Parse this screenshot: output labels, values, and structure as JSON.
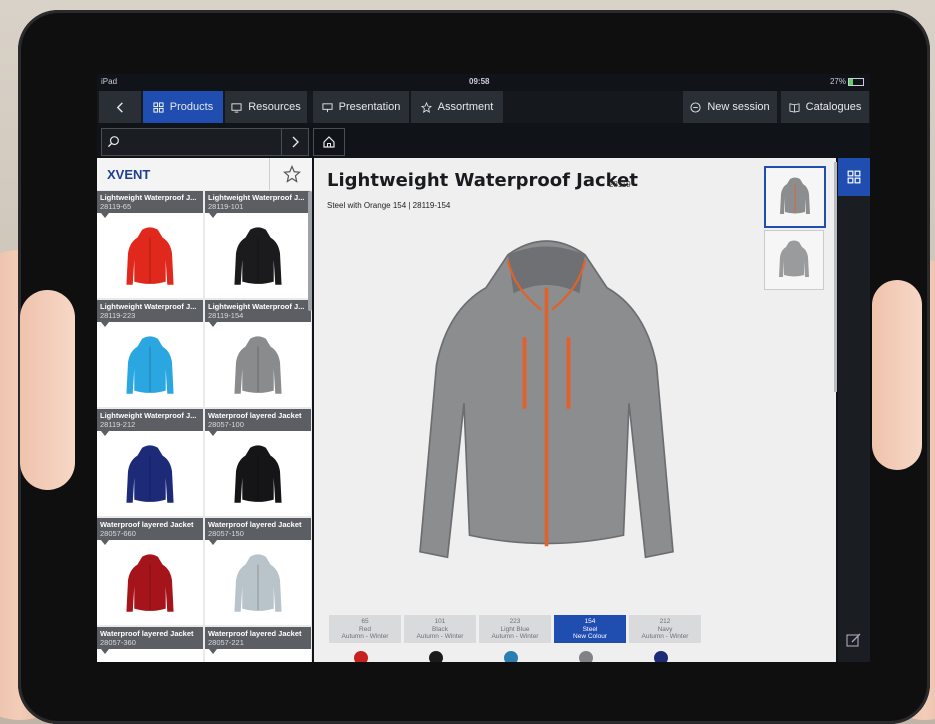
{
  "status": {
    "carrier": "iPad",
    "time": "09:58",
    "battery": "27%"
  },
  "nav": {
    "back_icon": "chevron-left-icon",
    "tabs": [
      {
        "label": "Products",
        "icon": "grid-icon",
        "active": true
      },
      {
        "label": "Resources",
        "icon": "monitor-icon",
        "active": false
      },
      {
        "label": "Presentation",
        "icon": "presentation-icon",
        "active": false
      },
      {
        "label": "Assortment",
        "icon": "star-icon",
        "active": false
      }
    ],
    "right": [
      {
        "label": "New session",
        "icon": "plus-circle-icon"
      },
      {
        "label": "Catalogues",
        "icon": "book-icon"
      }
    ]
  },
  "search": {
    "placeholder": "",
    "value": ""
  },
  "list": {
    "brand": "XVENT",
    "items": [
      {
        "name": "Lightweight Waterproof J...",
        "code": "28119-65",
        "color": "#e0281c"
      },
      {
        "name": "Lightweight Waterproof J...",
        "code": "28119-101",
        "color": "#1b1b1d"
      },
      {
        "name": "Lightweight Waterproof J...",
        "code": "28119-223",
        "color": "#2aa7e0"
      },
      {
        "name": "Lightweight Waterproof J...",
        "code": "28119-154",
        "color": "#8a8b8d"
      },
      {
        "name": "Lightweight Waterproof J...",
        "code": "28119-212",
        "color": "#1c2a78"
      },
      {
        "name": "Waterproof layered Jacket",
        "code": "28057-100",
        "color": "#151517"
      },
      {
        "name": "Waterproof layered Jacket",
        "code": "28057-660",
        "color": "#a5141a"
      },
      {
        "name": "Waterproof layered Jacket",
        "code": "28057-150",
        "color": "#b8c3ca"
      },
      {
        "name": "Waterproof layered Jacket",
        "code": "28057-360",
        "color": "#b0b0b0"
      },
      {
        "name": "Waterproof layered Jacket",
        "code": "28057-221",
        "color": "#b0b0b0"
      }
    ]
  },
  "product": {
    "title": "Lightweight Waterproof Jacket",
    "code": "28119",
    "subtitle": "Steel with Orange  154  |  28119-154",
    "main_color": "#8c8d8f",
    "accent_color": "#e0622a"
  },
  "thumbnails": [
    {
      "color": "#8c8d8f",
      "selected": true
    },
    {
      "color": "#9a9b9d",
      "selected": false
    }
  ],
  "swatches": [
    {
      "code": "65",
      "name": "Red",
      "season": "Autumn - Winter",
      "dot": "#c8201e",
      "selected": false
    },
    {
      "code": "101",
      "name": "Black",
      "season": "Autumn - Winter",
      "dot": "#1a1a1c",
      "selected": false
    },
    {
      "code": "223",
      "name": "Light Blue",
      "season": "Autumn - Winter",
      "dot": "#2a7fb0",
      "selected": false
    },
    {
      "code": "154",
      "name": "Steel",
      "season": "New Colour",
      "dot": "#808285",
      "selected": true
    },
    {
      "code": "212",
      "name": "Navy",
      "season": "Autumn - Winter",
      "dot": "#1c2a78",
      "selected": false
    }
  ],
  "colors": {
    "accent": "#1f4db0",
    "dark": "#101317"
  }
}
